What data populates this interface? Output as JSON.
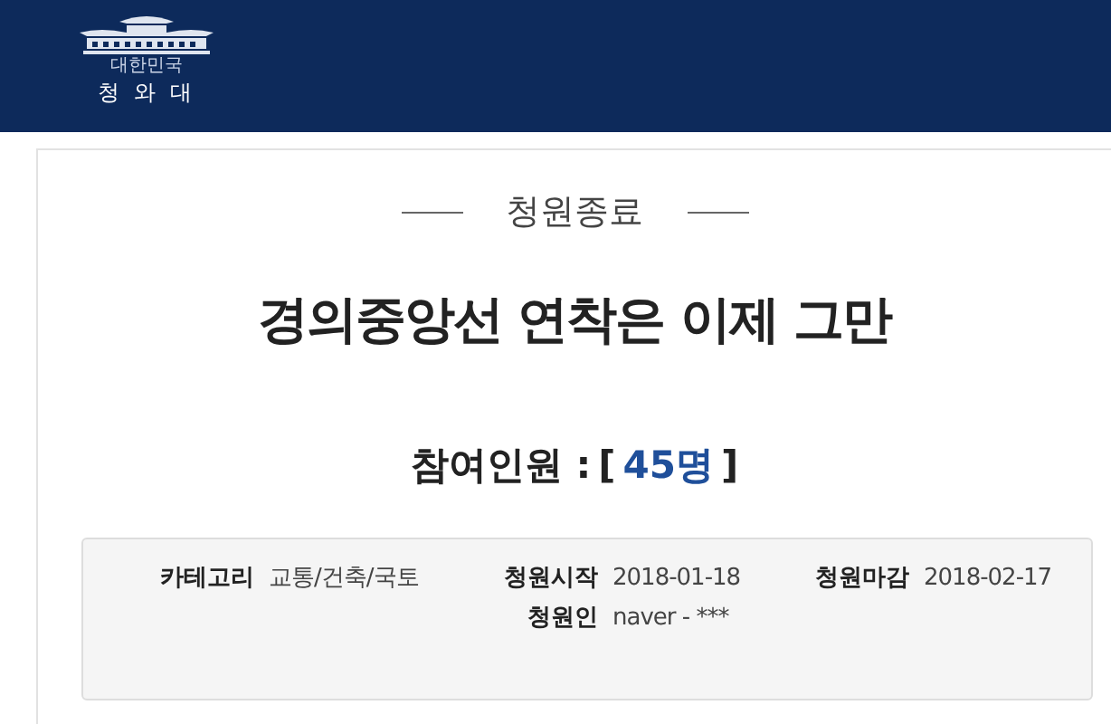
{
  "header": {
    "logo": {
      "subtitle": "대한민국",
      "name": "청 와 대"
    }
  },
  "petition": {
    "status": "청원종료",
    "title": "경의중앙선 연착은 이제 그만",
    "participants": {
      "label": "참여인원 :",
      "open": "[",
      "count": "45명",
      "close": "]"
    },
    "details": [
      {
        "label": "카테고리",
        "value": "교통/건축/국토"
      },
      {
        "label": "청원시작",
        "value": "2018-01-18"
      },
      {
        "label": "청원마감",
        "value": "2018-02-17"
      },
      {
        "label": "청원인",
        "value": "naver - ***"
      }
    ]
  }
}
